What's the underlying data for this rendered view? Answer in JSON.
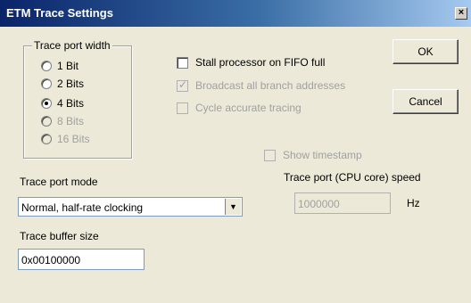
{
  "window": {
    "title": "ETM Trace Settings",
    "close_glyph": "×"
  },
  "trace_port_width": {
    "title": "Trace port width",
    "options": [
      {
        "label": "1 Bit",
        "checked": false,
        "disabled": false
      },
      {
        "label": "2 Bits",
        "checked": false,
        "disabled": false
      },
      {
        "label": "4 Bits",
        "checked": true,
        "disabled": false
      },
      {
        "label": "8 Bits",
        "checked": false,
        "disabled": true
      },
      {
        "label": "16 Bits",
        "checked": false,
        "disabled": true
      }
    ]
  },
  "options": {
    "stall_processor": {
      "label": "Stall processor on FIFO full",
      "checked": false,
      "disabled": false
    },
    "broadcast_branch": {
      "label": "Broadcast all branch addresses",
      "checked": true,
      "disabled": true
    },
    "cycle_accurate": {
      "label": "Cycle accurate tracing",
      "checked": false,
      "disabled": true
    },
    "show_timestamp": {
      "label": "Show timestamp",
      "checked": false,
      "disabled": true
    }
  },
  "buttons": {
    "ok": "OK",
    "cancel": "Cancel"
  },
  "trace_port_mode": {
    "label": "Trace port mode",
    "value": "Normal, half-rate clocking"
  },
  "trace_buffer_size": {
    "label": "Trace buffer size",
    "value": "0x00100000"
  },
  "trace_port_speed": {
    "label": "Trace port (CPU core) speed",
    "value": "1000000",
    "unit": "Hz"
  }
}
